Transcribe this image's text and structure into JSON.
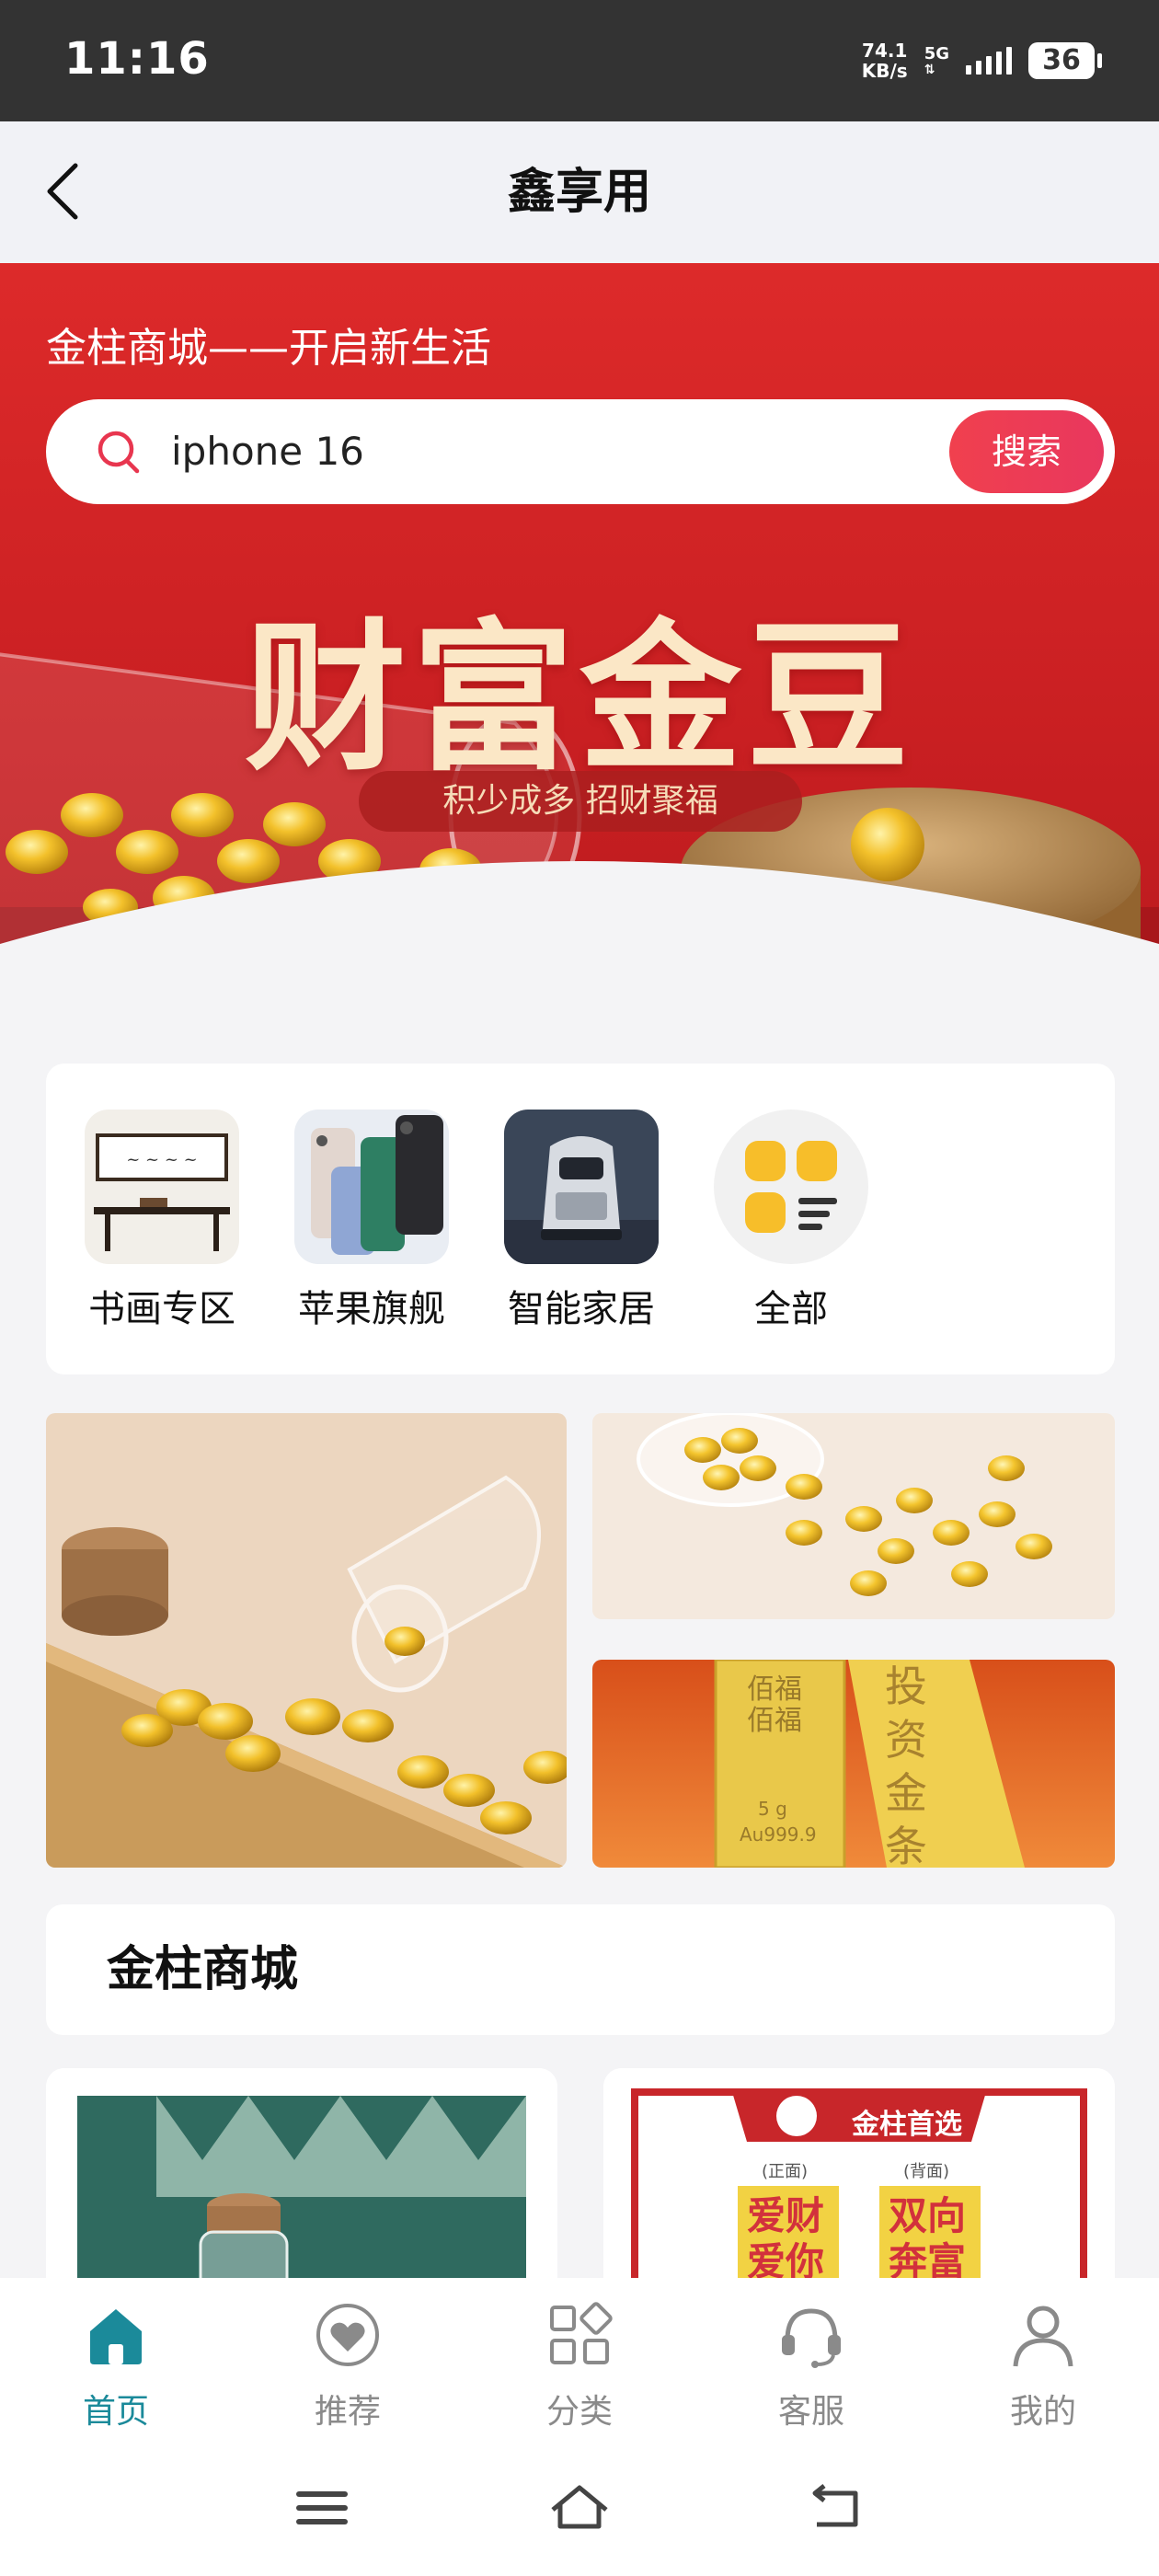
{
  "status_bar": {
    "time": "11:16",
    "net_speed_value": "74.1",
    "net_speed_unit": "KB/s",
    "network": "5G",
    "battery": "36"
  },
  "nav": {
    "title": "鑫享用",
    "back_icon": "chevron-left-icon"
  },
  "hero": {
    "slogan": "金柱商城——开启新生活",
    "search": {
      "value": "iphone 16",
      "button_label": "搜索",
      "icon": "search-icon"
    },
    "banner": {
      "title": "财富金豆",
      "subtitle": "积少成多 招财聚福"
    }
  },
  "categories": [
    {
      "label": "书画专区",
      "icon": "calligraphy-desk-image"
    },
    {
      "label": "苹果旗舰",
      "icon": "iphone-image"
    },
    {
      "label": "智能家居",
      "icon": "robot-image"
    },
    {
      "label": "全部",
      "icon": "grid-menu-icon"
    }
  ],
  "promos": {
    "bar_left_text": "佰福 佰福",
    "bar_left_spec": "5 g",
    "bar_left_purity": "Au999.9",
    "bar_right_text": "投资金条"
  },
  "section": {
    "title": "金柱商城"
  },
  "products": {
    "right_badge": "金柱首选",
    "right_face_front": "(正面)",
    "right_face_back": "(背面)",
    "right_bar_front": "爱财爱你",
    "right_bar_back": "双向奔富"
  },
  "tabs": [
    {
      "label": "首页",
      "icon": "home-icon",
      "active": true
    },
    {
      "label": "推荐",
      "icon": "heart-icon",
      "active": false
    },
    {
      "label": "分类",
      "icon": "category-icon",
      "active": false
    },
    {
      "label": "客服",
      "icon": "headset-icon",
      "active": false
    },
    {
      "label": "我的",
      "icon": "user-icon",
      "active": false
    }
  ],
  "system_nav": [
    "menu-icon",
    "home-outline-icon",
    "back-icon"
  ],
  "colors": {
    "brand_red": "#d8262b",
    "search_button": "#ee3c55",
    "active_tab": "#1b8a9a",
    "inactive_tab": "#8a8a8a"
  }
}
